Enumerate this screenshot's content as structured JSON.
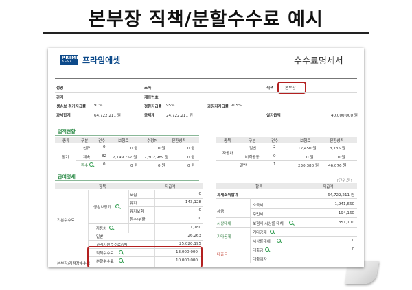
{
  "page_title": "본부장 직책/분할수수료 예시",
  "logo": {
    "line1": "PRIME",
    "line2": "ASSET",
    "name": "프라임에셋"
  },
  "doc_title": "수수료명세서",
  "info": {
    "name_label": "성명",
    "affiliation_label": "소속",
    "position_label": "직책",
    "position_value": "본부장",
    "rank_label": "관리",
    "account_label": "계좌번호",
    "retention_label": "생손보 경거지급률",
    "retention_value": "97%",
    "pay_rate_label": "정환지급률",
    "pay_rate_value": "95%",
    "tax_label": "과징지지급률",
    "tax_value": "-0.5%",
    "total_label": "과세합계",
    "total_value": "64,722,211 원",
    "deduct_label": "공제계",
    "deduct_value": "24,722,211 원",
    "actual_label": "실지급액",
    "actual_value": "40,000,000 원"
  },
  "performance": {
    "section_title": "업적현황",
    "left_headers": [
      "종류",
      "구분",
      "건수",
      "보험료",
      "수정P",
      "전환성적"
    ],
    "left_rows": [
      {
        "kind": "",
        "type": "신규",
        "count": "0",
        "premium": "0 원",
        "modp": "0 원",
        "conv": "0 원"
      },
      {
        "kind": "장기",
        "type": "계속",
        "count": "82",
        "premium": "7,149,757 원",
        "modp": "2,302,989 원",
        "conv": "0 원"
      },
      {
        "kind": "",
        "type": "환수",
        "count": "0",
        "premium": "0 원",
        "modp": "0 원",
        "conv": "0 원"
      }
    ],
    "right_headers": [
      "종목",
      "구분",
      "건수",
      "보험료",
      "전환성적"
    ],
    "right_rows": [
      {
        "kind": "",
        "type": "일반",
        "count": "2",
        "premium": "12,450 원",
        "conv": "3,735 원"
      },
      {
        "kind": "자동차",
        "type": "비격공동",
        "count": "0",
        "premium": "0 원",
        "conv": "0 원"
      },
      {
        "kind": "일반",
        "type": "",
        "count": "1",
        "premium": "230,380 원",
        "conv": "46,076 원"
      }
    ]
  },
  "pay": {
    "section_title": "급여명세",
    "headers": [
      "항목",
      "지급액"
    ],
    "left_rows": [
      {
        "label": "모집",
        "value": "0"
      },
      {
        "label": "유지",
        "value": "143,128"
      },
      {
        "label": "유지보험",
        "value": "0"
      },
      {
        "label": "환수/부활",
        "value": "0"
      },
      {
        "label": "자동차",
        "value": "1,780"
      },
      {
        "label": "일반",
        "value": "26,263"
      },
      {
        "label": "관리지원수수료(연)",
        "value": "25,020,195"
      },
      {
        "label": "직책수수료",
        "value": "13,000,000"
      },
      {
        "label": "분할수수료",
        "value": "10,000,000"
      }
    ],
    "group_base": "기본수수료",
    "group_life": "생손보장기",
    "group_bonus": "본부장/지점장수수료",
    "unit_note": "[단위:원]",
    "right_rows": [
      {
        "label": "소득세",
        "value": "1,941,660"
      },
      {
        "label": "주민세",
        "value": "194,160"
      },
      {
        "label": "보험사 시상롤 대체",
        "value": "351,100"
      },
      {
        "label": "기타공제",
        "value": ""
      },
      {
        "label": "시상롤대체",
        "value": "0"
      },
      {
        "label": "대출금",
        "value": "0"
      },
      {
        "label": "대출이자",
        "value": ""
      }
    ],
    "taxable_label": "과세소득합계",
    "taxable_value": "64,722,211 원",
    "tax_group": "세금",
    "sisang_group": "시상대체",
    "etc_group": "기타공제",
    "loan_group": "대출금"
  }
}
